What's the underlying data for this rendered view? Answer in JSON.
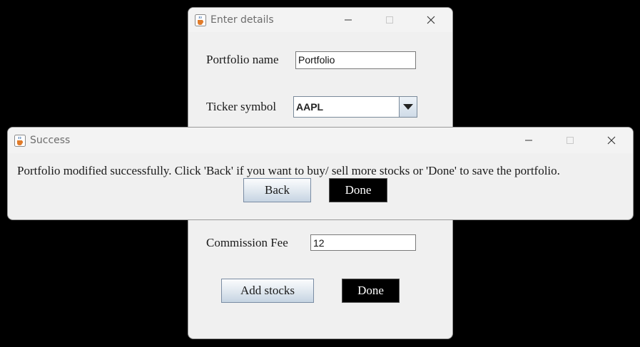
{
  "background_window": {
    "title": "Enter details",
    "portfolio_name_label": "Portfolio name",
    "portfolio_name_value": "Portfolio",
    "ticker_label": "Ticker symbol",
    "ticker_selected": "AAPL",
    "commission_label": "Commission Fee",
    "commission_value": "12",
    "add_stocks_label": "Add stocks",
    "done_label": "Done"
  },
  "dialog": {
    "title": "Success",
    "message": "Portfolio modified successfully. Click 'Back' if you want to buy/ sell more stocks or 'Done' to save the portfolio.",
    "back_label": "Back",
    "done_label": "Done"
  },
  "icons": {
    "app": "java-cup-icon",
    "minimize": "minimize-icon",
    "maximize": "maximize-icon",
    "close": "close-icon",
    "dropdown": "chevron-down-icon"
  }
}
